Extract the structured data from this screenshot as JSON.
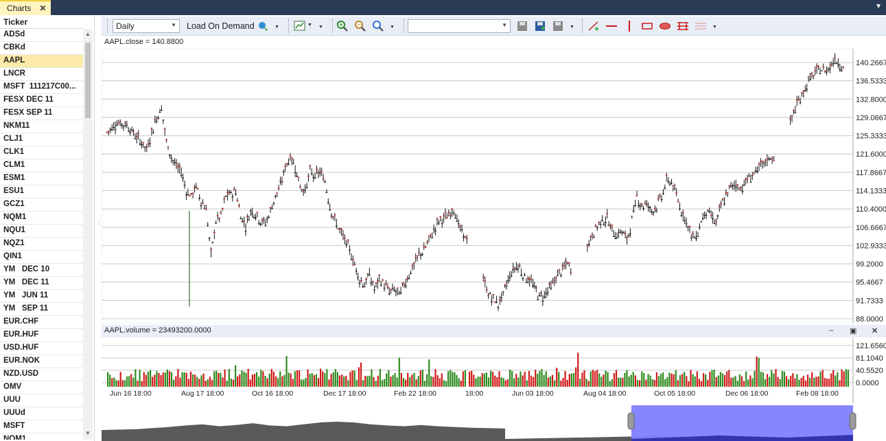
{
  "tab": {
    "label": "Charts",
    "close": "✕"
  },
  "tickers": {
    "header": "Ticker",
    "selected": 2,
    "items": [
      "ADSd",
      "CBKd",
      "AAPL",
      "LNCR",
      "MSFT  111217C00...",
      "FESX DEC 11",
      "FESX SEP 11",
      "NKM11",
      "CLJ1",
      "CLK1",
      "CLM1",
      "ESM1",
      "ESU1",
      "GCZ1",
      "NQM1",
      "NQU1",
      "NQZ1",
      "QIN1",
      "YM   DEC 10",
      "YM   DEC 11",
      "YM   JUN 11",
      "YM   SEP 11",
      "EUR.CHF",
      "EUR.HUF",
      "USD.HUF",
      "EUR.NOK",
      "NZD.USD",
      "OMV",
      "UUU",
      "UUUd",
      "MSFT",
      "NQM1"
    ]
  },
  "toolbar": {
    "period": "Daily",
    "load_on_demand": "Load On Demand",
    "template_value": ""
  },
  "price_pane": {
    "title": "AAPL.close = 140.8800",
    "ticks": [
      "140.2667",
      "136.5333",
      "132.8000",
      "129.0667",
      "125.3333",
      "121.6000",
      "117.8667",
      "114.1333",
      "110.4000",
      "106.6667",
      "102.9333",
      "99.2000",
      "95.4667",
      "91.7333",
      "88.0000"
    ]
  },
  "volume_pane": {
    "title": "AAPL.volume = 23493200.0000",
    "ticks": [
      "121.6560",
      "81.1040",
      "40.5520",
      "0.0000"
    ]
  },
  "x_axis": {
    "labels": [
      "Jun 16 18:00",
      "Aug 17 18:00",
      "Oct 16 18:00",
      "Dec 17 18:00",
      "Feb 22 18:00",
      "18:00",
      "Jun 03 18:00",
      "Aug 04 18:00",
      "Oct 05 18:00",
      "Dec 06 18:00",
      "Feb 08 18:00"
    ]
  },
  "colors": {
    "up": "#2e8b1e",
    "down": "#d11a1a",
    "candle": "#111111",
    "navigator_sel": "#8080ff",
    "navigator_area": "#5a5a5a"
  },
  "chart_data": {
    "type": "candlestick",
    "title": "AAPL.close = 140.8800",
    "ylim": [
      88,
      142
    ],
    "close_path": [
      [
        0,
        126
      ],
      [
        2,
        128
      ],
      [
        4,
        127.5
      ],
      [
        6,
        125
      ],
      [
        7,
        124
      ],
      [
        8,
        122.5
      ],
      [
        9,
        126
      ],
      [
        10,
        129
      ],
      [
        11,
        131
      ],
      [
        12,
        124
      ],
      [
        13,
        121
      ],
      [
        14,
        119
      ],
      [
        15,
        118
      ],
      [
        16,
        114
      ],
      [
        17,
        113
      ],
      [
        18,
        115
      ],
      [
        19,
        112
      ],
      [
        20,
        110.5
      ],
      [
        21,
        101
      ],
      [
        22,
        108
      ],
      [
        23,
        109
      ],
      [
        24,
        113
      ],
      [
        25,
        113.5
      ],
      [
        26,
        114
      ],
      [
        27,
        109
      ],
      [
        28,
        107
      ],
      [
        29,
        110
      ],
      [
        30,
        109.5
      ],
      [
        31,
        108
      ],
      [
        32,
        107.5
      ],
      [
        33,
        110
      ],
      [
        34,
        113
      ],
      [
        35,
        115
      ],
      [
        36,
        119
      ],
      [
        37,
        121
      ],
      [
        38,
        119
      ],
      [
        39,
        115
      ],
      [
        40,
        114
      ],
      [
        41,
        118
      ],
      [
        42,
        117
      ],
      [
        43,
        118
      ],
      [
        44,
        116
      ],
      [
        45,
        111
      ],
      [
        46,
        108
      ],
      [
        47,
        106
      ],
      [
        48,
        104
      ],
      [
        49,
        102
      ],
      [
        50,
        99
      ],
      [
        51,
        96
      ],
      [
        52,
        95
      ],
      [
        53,
        97
      ],
      [
        54,
        94
      ],
      [
        55,
        96
      ],
      [
        56,
        95
      ],
      [
        57,
        93.5
      ],
      [
        58,
        94
      ],
      [
        59,
        93
      ],
      [
        60,
        95
      ],
      [
        61,
        97
      ],
      [
        62,
        99
      ],
      [
        63,
        101
      ],
      [
        64,
        102
      ],
      [
        65,
        104
      ],
      [
        66,
        106
      ],
      [
        67,
        108
      ],
      [
        68,
        108.5
      ],
      [
        69,
        109
      ],
      [
        70,
        110.5
      ],
      [
        71,
        107
      ],
      [
        72,
        105
      ],
      [
        73,
        104
      ],
      [
        76,
        96
      ],
      [
        77,
        93
      ],
      [
        78,
        92
      ],
      [
        79,
        91
      ],
      [
        80,
        93
      ],
      [
        81,
        96
      ],
      [
        82,
        98
      ],
      [
        83,
        99
      ],
      [
        84,
        97
      ],
      [
        85,
        96
      ],
      [
        86,
        95
      ],
      [
        87,
        93
      ],
      [
        88,
        92.5
      ],
      [
        89,
        94
      ],
      [
        90,
        95
      ],
      [
        91,
        97
      ],
      [
        92,
        98
      ],
      [
        93,
        99.5
      ],
      [
        94,
        97
      ],
      [
        97,
        103
      ],
      [
        98,
        105
      ],
      [
        99,
        107
      ],
      [
        100,
        108
      ],
      [
        101,
        108.5
      ],
      [
        102,
        106
      ],
      [
        103,
        105
      ],
      [
        104,
        106
      ],
      [
        105,
        104
      ],
      [
        106,
        108
      ],
      [
        107,
        113
      ],
      [
        108,
        111
      ],
      [
        109,
        111.5
      ],
      [
        110,
        110
      ],
      [
        111,
        111
      ],
      [
        112,
        113
      ],
      [
        113,
        116
      ],
      [
        114,
        116
      ],
      [
        115,
        113
      ],
      [
        116,
        110
      ],
      [
        117,
        108
      ],
      [
        118,
        105
      ],
      [
        119,
        104.5
      ],
      [
        120,
        108
      ],
      [
        121,
        110
      ],
      [
        122,
        109
      ],
      [
        123,
        107.5
      ],
      [
        124,
        111
      ],
      [
        125,
        113
      ],
      [
        126,
        115
      ],
      [
        127,
        115.5
      ],
      [
        128,
        114.5
      ],
      [
        129,
        116
      ],
      [
        130,
        117
      ],
      [
        131,
        118
      ],
      [
        132,
        119
      ],
      [
        133,
        120
      ],
      [
        134,
        121
      ],
      [
        135,
        120.5
      ],
      [
        138,
        128
      ],
      [
        139,
        131
      ],
      [
        140,
        133
      ],
      [
        141,
        135
      ],
      [
        142,
        137
      ],
      [
        143,
        138
      ],
      [
        144,
        139
      ],
      [
        145,
        138.5
      ],
      [
        146,
        139.5
      ],
      [
        147,
        141
      ],
      [
        148,
        140
      ],
      [
        149,
        139
      ]
    ],
    "volume_y": [
      0,
      121.656
    ]
  },
  "navigator": {
    "area": [
      [
        0,
        40
      ],
      [
        10,
        42
      ],
      [
        20,
        48
      ],
      [
        25,
        52
      ],
      [
        30,
        55
      ],
      [
        35,
        50
      ],
      [
        40,
        53
      ],
      [
        45,
        58
      ],
      [
        50,
        52
      ],
      [
        55,
        50
      ],
      [
        60,
        55
      ],
      [
        65,
        60
      ],
      [
        70,
        62
      ],
      [
        75,
        60
      ],
      [
        80,
        55
      ],
      [
        85,
        52
      ],
      [
        90,
        50
      ],
      [
        95,
        53
      ],
      [
        100,
        50
      ],
      [
        105,
        48
      ],
      [
        110,
        46
      ],
      [
        115,
        45
      ],
      [
        120,
        44
      ]
    ]
  }
}
